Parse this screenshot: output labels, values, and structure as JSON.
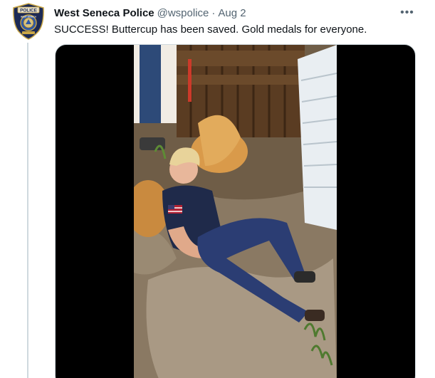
{
  "tweet": {
    "author_name": "West Seneca Police",
    "handle": "@wspolice",
    "separator": "·",
    "date": "Aug 2",
    "more_label": "•••",
    "text": "SUCCESS! Buttercup has been saved. Gold medals for everyone."
  },
  "avatar": {
    "badge_text_top": "POLICE",
    "badge_text_bottom": "WEST SENECA"
  },
  "colors": {
    "name": "#0f1419",
    "secondary": "#536471",
    "border": "#cfd9de",
    "media_background": "#000000"
  },
  "media": {
    "type": "video",
    "description_icon": "video-thumbnail"
  }
}
